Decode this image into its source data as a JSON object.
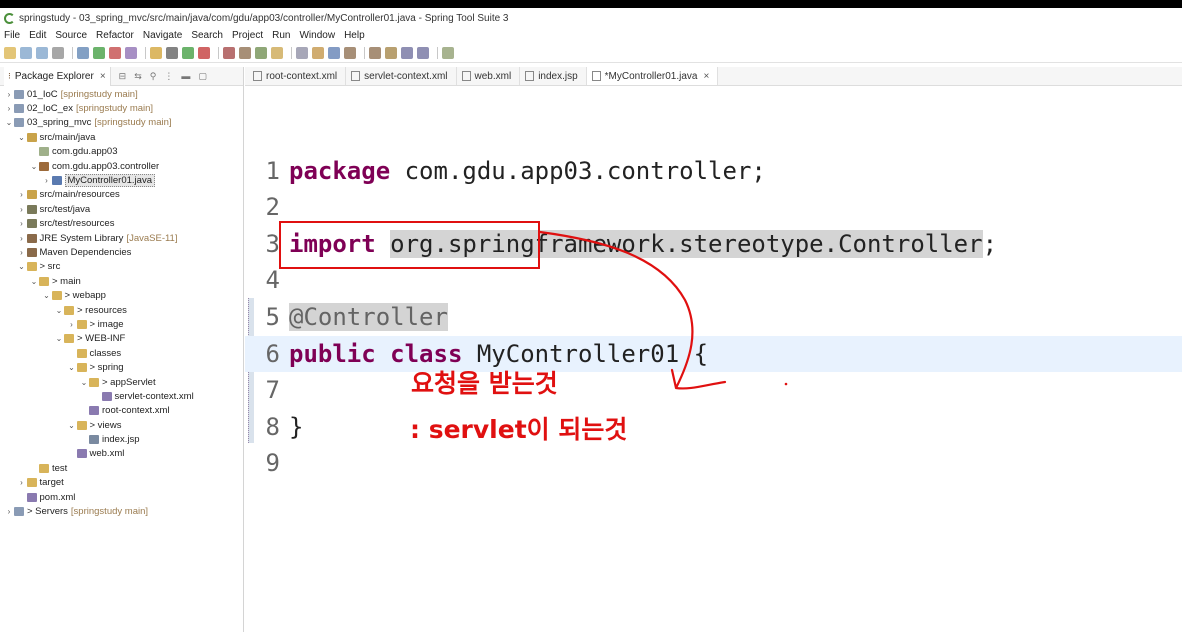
{
  "window_title": "springstudy - 03_spring_mvc/src/main/java/com/gdu/app03/controller/MyController01.java - Spring Tool Suite 3",
  "menu": [
    "File",
    "Edit",
    "Source",
    "Refactor",
    "Navigate",
    "Search",
    "Project",
    "Run",
    "Window",
    "Help"
  ],
  "explorer": {
    "tab_label": "Package Explorer",
    "close": "×",
    "items": [
      {
        "label": "01_IoC",
        "decoration": "[springstudy main]",
        "depth": 0,
        "twisty": ">",
        "icon": "project-icon",
        "color": "#8a9bb5"
      },
      {
        "label": "02_IoC_ex",
        "decoration": "[springstudy main]",
        "depth": 0,
        "twisty": ">",
        "icon": "project-icon",
        "color": "#8a9bb5"
      },
      {
        "label": "03_spring_mvc",
        "decoration": "[springstudy main]",
        "depth": 0,
        "twisty": "v",
        "icon": "project-icon",
        "color": "#8a9bb5"
      },
      {
        "label": "src/main/java",
        "decoration": "",
        "depth": 1,
        "twisty": "v",
        "icon": "source-folder-icon",
        "color": "#c9a34a"
      },
      {
        "label": "com.gdu.app03",
        "decoration": "",
        "depth": 2,
        "twisty": "",
        "icon": "package-icon",
        "color": "#9fb08a"
      },
      {
        "label": "com.gdu.app03.controller",
        "decoration": "",
        "depth": 2,
        "twisty": "v",
        "icon": "package-icon",
        "color": "#9c6a3a"
      },
      {
        "label": "MyController01.java",
        "decoration": "",
        "depth": 3,
        "twisty": ">",
        "icon": "java-file-icon",
        "color": "#5a7ab0",
        "selected": true
      },
      {
        "label": "src/main/resources",
        "decoration": "",
        "depth": 1,
        "twisty": ">",
        "icon": "source-folder-icon",
        "color": "#c9a34a"
      },
      {
        "label": "src/test/java",
        "decoration": "",
        "depth": 1,
        "twisty": ">",
        "icon": "source-folder-icon",
        "color": "#7a7a5a"
      },
      {
        "label": "src/test/resources",
        "decoration": "",
        "depth": 1,
        "twisty": ">",
        "icon": "source-folder-icon",
        "color": "#7a7a5a"
      },
      {
        "label": "JRE System Library",
        "decoration": "[JavaSE-11]",
        "depth": 1,
        "twisty": ">",
        "icon": "library-icon",
        "color": "#8a6a4a"
      },
      {
        "label": "Maven Dependencies",
        "decoration": "",
        "depth": 1,
        "twisty": ">",
        "icon": "library-icon",
        "color": "#8a6a4a"
      },
      {
        "label": "> src",
        "decoration": "",
        "depth": 1,
        "twisty": "v",
        "icon": "folder-icon",
        "color": "#d8b45a"
      },
      {
        "label": "> main",
        "decoration": "",
        "depth": 2,
        "twisty": "v",
        "icon": "folder-icon",
        "color": "#d8b45a"
      },
      {
        "label": "> webapp",
        "decoration": "",
        "depth": 3,
        "twisty": "v",
        "icon": "folder-icon",
        "color": "#d8b45a"
      },
      {
        "label": "> resources",
        "decoration": "",
        "depth": 4,
        "twisty": "v",
        "icon": "folder-icon",
        "color": "#d8b45a"
      },
      {
        "label": "> image",
        "decoration": "",
        "depth": 5,
        "twisty": ">",
        "icon": "folder-icon",
        "color": "#d8b45a"
      },
      {
        "label": "> WEB-INF",
        "decoration": "",
        "depth": 4,
        "twisty": "v",
        "icon": "folder-icon",
        "color": "#d8b45a"
      },
      {
        "label": "classes",
        "decoration": "",
        "depth": 5,
        "twisty": "",
        "icon": "folder-icon",
        "color": "#d8b45a"
      },
      {
        "label": "> spring",
        "decoration": "",
        "depth": 5,
        "twisty": "v",
        "icon": "folder-icon",
        "color": "#d8b45a"
      },
      {
        "label": "> appServlet",
        "decoration": "",
        "depth": 6,
        "twisty": "v",
        "icon": "folder-icon",
        "color": "#d8b45a"
      },
      {
        "label": "servlet-context.xml",
        "decoration": "",
        "depth": 7,
        "twisty": "",
        "icon": "xml-file-icon",
        "color": "#8a7ab0"
      },
      {
        "label": "root-context.xml",
        "decoration": "",
        "depth": 6,
        "twisty": "",
        "icon": "xml-file-icon",
        "color": "#8a7ab0"
      },
      {
        "label": "> views",
        "decoration": "",
        "depth": 5,
        "twisty": "v",
        "icon": "folder-icon",
        "color": "#d8b45a"
      },
      {
        "label": "index.jsp",
        "decoration": "",
        "depth": 6,
        "twisty": "",
        "icon": "jsp-file-icon",
        "color": "#7a8aa0"
      },
      {
        "label": "web.xml",
        "decoration": "",
        "depth": 5,
        "twisty": "",
        "icon": "xml-file-icon",
        "color": "#8a7ab0"
      },
      {
        "label": "test",
        "decoration": "",
        "depth": 2,
        "twisty": "",
        "icon": "folder-icon",
        "color": "#d8b45a"
      },
      {
        "label": "target",
        "decoration": "",
        "depth": 1,
        "twisty": ">",
        "icon": "folder-icon",
        "color": "#d8b45a"
      },
      {
        "label": "pom.xml",
        "decoration": "",
        "depth": 1,
        "twisty": "",
        "icon": "xml-file-icon",
        "color": "#8a7ab0"
      },
      {
        "label": "> Servers",
        "decoration": "[springstudy main]",
        "depth": 0,
        "twisty": ">",
        "icon": "folder-icon",
        "color": "#8a9bb5"
      }
    ]
  },
  "editor_tabs": [
    {
      "label": "root-context.xml",
      "icon": "xml-file-icon",
      "active": false
    },
    {
      "label": "servlet-context.xml",
      "icon": "xml-file-icon",
      "active": false
    },
    {
      "label": "web.xml",
      "icon": "xml-file-icon",
      "active": false
    },
    {
      "label": "index.jsp",
      "icon": "jsp-file-icon",
      "active": false
    },
    {
      "label": "*MyController01.java",
      "icon": "java-file-icon",
      "active": true
    }
  ],
  "code": {
    "line_numbers": [
      "1",
      "2",
      "3",
      "4",
      "5",
      "6",
      "7",
      "8",
      "9"
    ],
    "l1_kw": "package",
    "l1_rest": " com.gdu.app03.controller;",
    "l3_kw": "import",
    "l3_sp": " ",
    "l3_sel": "org.springframework.stereotype.Controller",
    "l3_end": ";",
    "l5_ann": "@Controller",
    "l6_kw1": "public",
    "l6_sp": " ",
    "l6_kw2": "class",
    "l6_rest": " MyController01 {",
    "l8": "}"
  },
  "annotation": {
    "note_line1": "요청을 받는것",
    "note_line2": ": servlet이 되는것",
    "color": "#e01010"
  },
  "colors": {
    "keyword": "#7f0055",
    "current_line": "#e8f2fe",
    "selection": "#d4d4d4"
  }
}
